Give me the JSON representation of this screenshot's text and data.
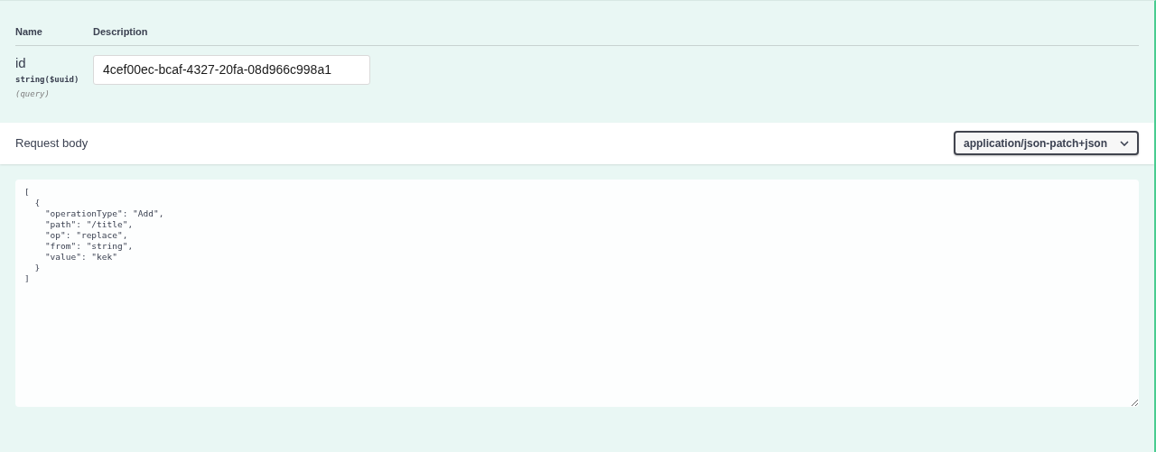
{
  "parameters": {
    "columns": [
      "Name",
      "Description"
    ],
    "rows": [
      {
        "name": "id",
        "type": "string($uuid)",
        "location": "(query)",
        "value": "4cef00ec-bcaf-4327-20fa-08d966c998a1"
      }
    ]
  },
  "request_body": {
    "title": "Request body",
    "content_type": "application/json-patch+json",
    "body": "[\n  {\n    \"operationType\": \"Add\",\n    \"path\": \"/title\",\n    \"op\": \"replace\",\n    \"from\": \"string\",\n    \"value\": \"kek\"\n  }\n]"
  }
}
